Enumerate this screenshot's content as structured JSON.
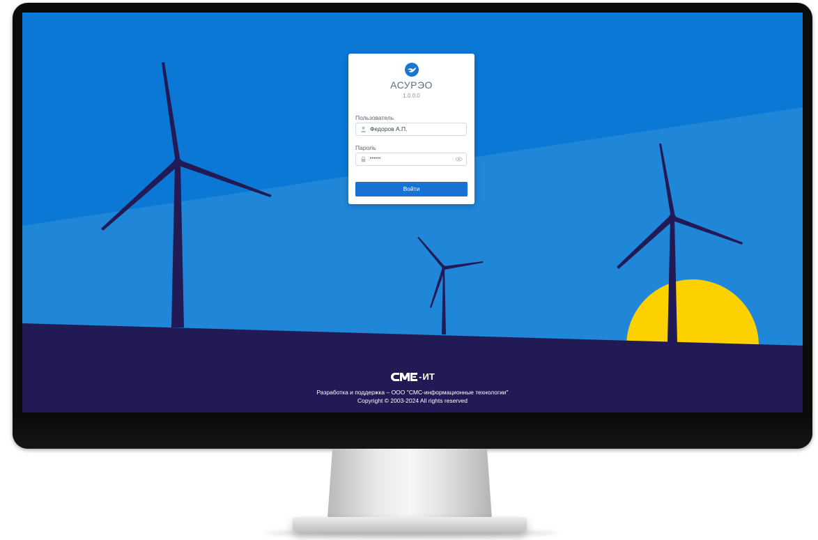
{
  "login": {
    "app_name": "АСУРЭО",
    "version": "1.0.0.0",
    "username_label": "Пользователь",
    "username_value": "Федоров А.П.",
    "password_label": "Пароль",
    "password_value": "••••••",
    "submit_label": "Войти"
  },
  "footer": {
    "logo_text": "ИТ",
    "logo_prefix": "-",
    "developer_line": "Разработка и поддержка – ООО \"СМС-информационные технологии\"",
    "copyright_line": "Copyright © 2003-2024 All rights reserved"
  },
  "icons": {
    "app_logo": "bird-logo-icon",
    "user": "user-icon",
    "lock": "lock-icon",
    "password_visibility": "eye-icon"
  },
  "colors": {
    "sky_upper": "#0a78d4",
    "sky_lower": "#1f86d8",
    "ground": "#221a55",
    "turbine": "#221a55",
    "sun": "#fdd100",
    "button": "#1673d3",
    "logo": "#1976d2"
  }
}
